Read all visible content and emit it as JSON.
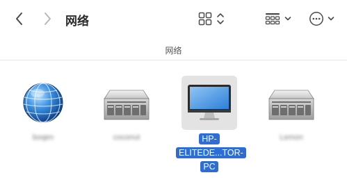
{
  "window": {
    "title": "网络"
  },
  "pathbar": {
    "label": "网络"
  },
  "toolbar": {
    "back_icon": "chevron-left-icon",
    "forward_icon": "chevron-right-icon",
    "view_icon": "icon-grid-icon",
    "group_icon": "group-by-icon",
    "more_icon": "ellipsis-circle-icon"
  },
  "items": [
    {
      "label": "boqen",
      "icon": "network-globe-icon",
      "selected": false
    },
    {
      "label": "coconut",
      "icon": "server-icon",
      "selected": false
    },
    {
      "label_line1": "HP-",
      "label_line2": "ELITEDE...TOR-PC",
      "icon": "display-icon",
      "selected": true
    },
    {
      "label": "Lemon",
      "icon": "server-icon",
      "selected": false
    }
  ],
  "colors": {
    "selection": "#2c6ed5",
    "selected_bg": "#e3e3e3"
  }
}
